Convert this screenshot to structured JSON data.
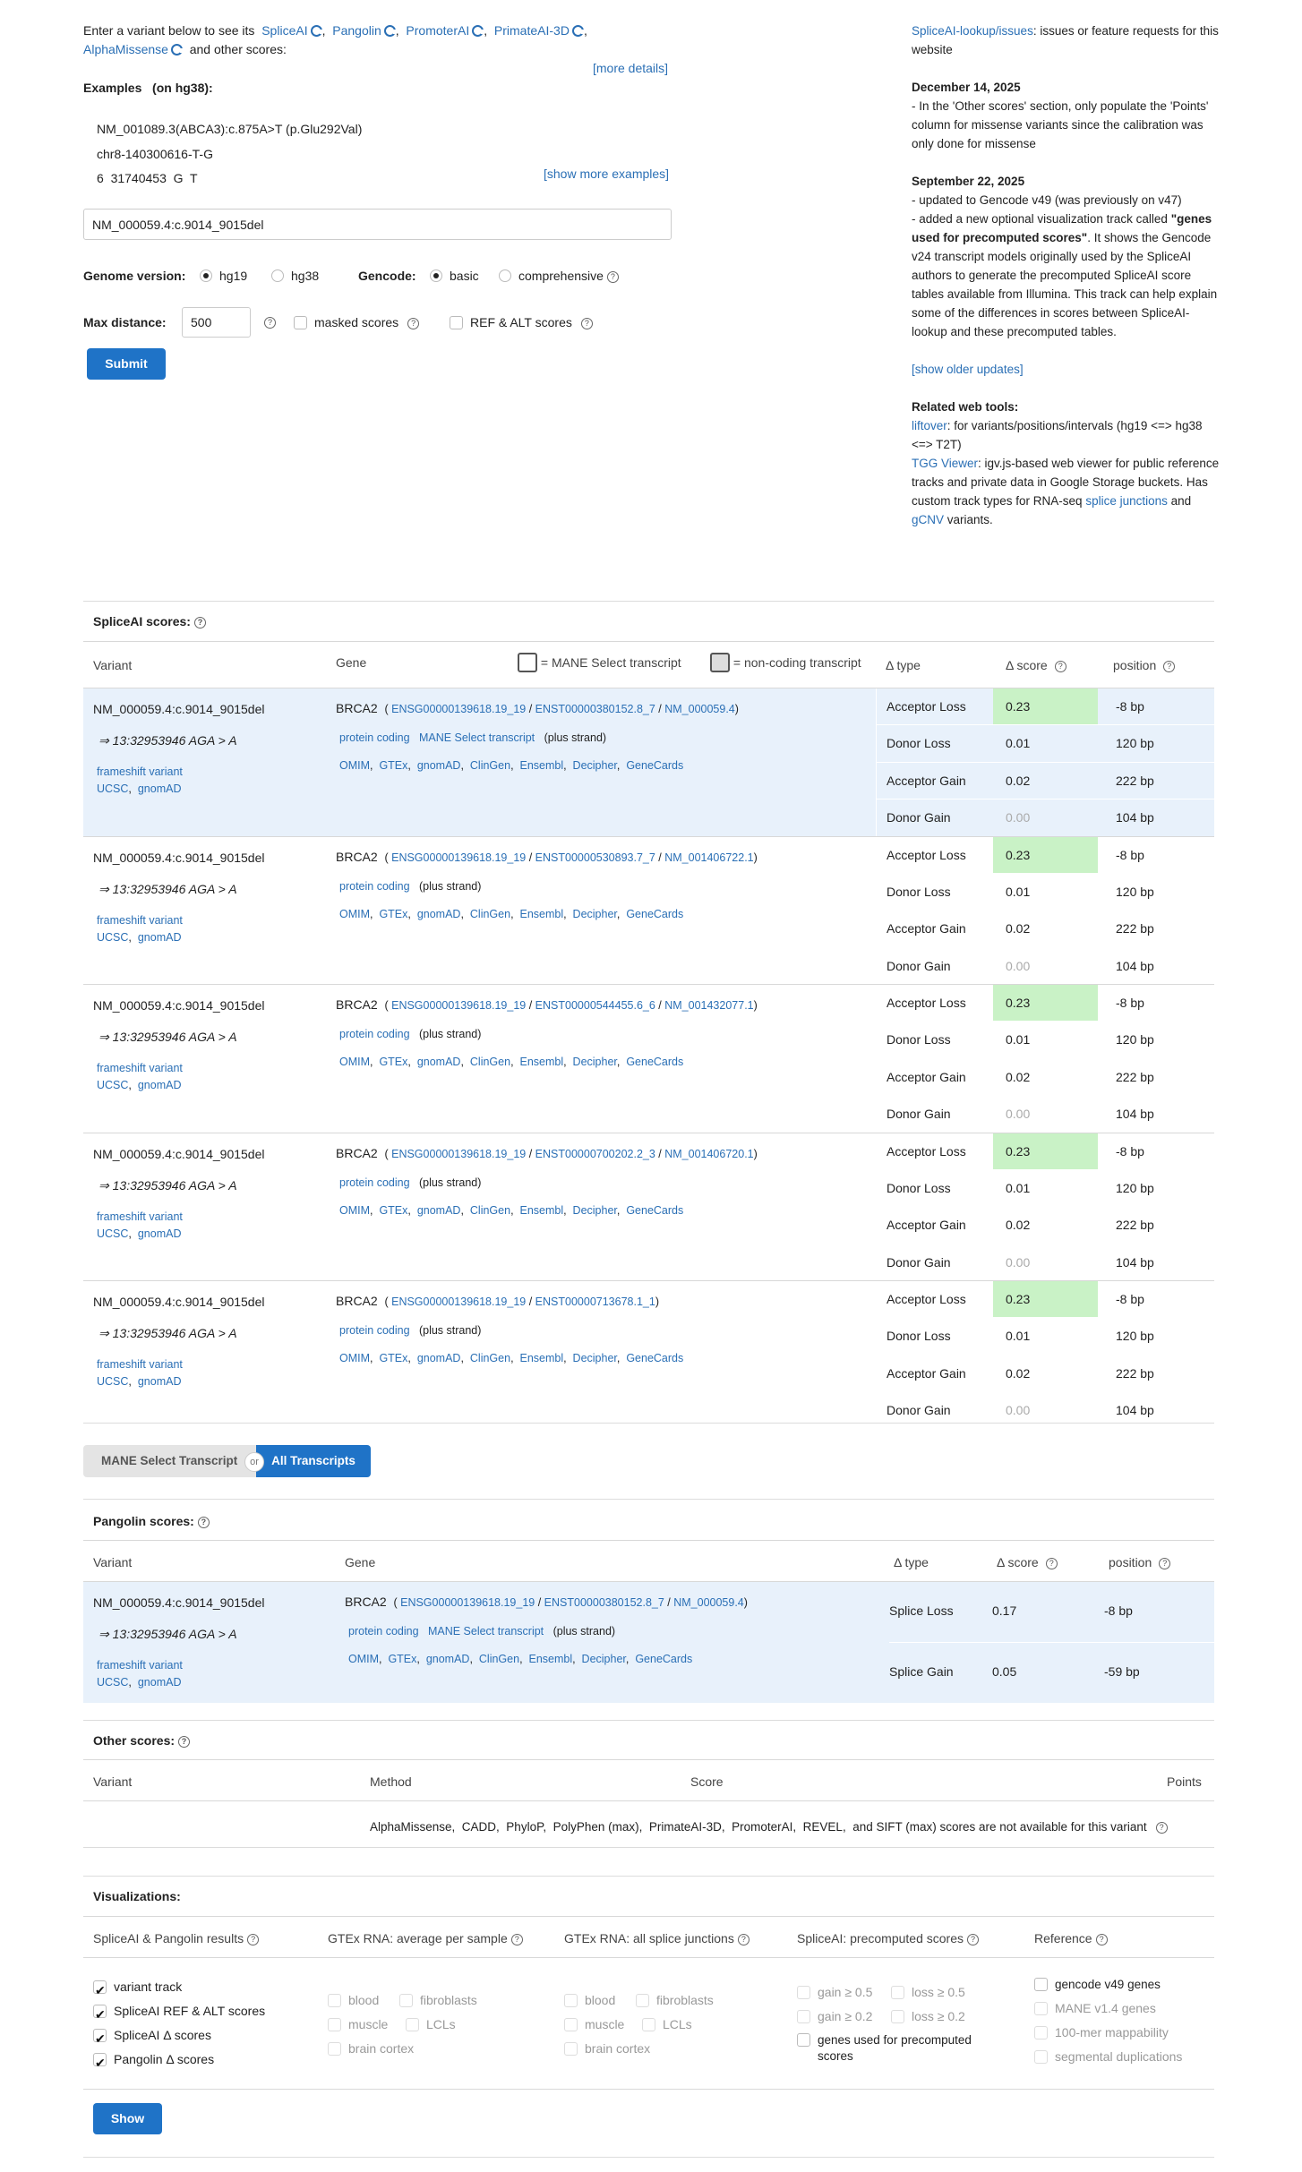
{
  "intro": {
    "text1": "Enter a variant below to see its",
    "tools": [
      "SpliceAI",
      "Pangolin",
      "PromoterAI",
      "PrimateAI-3D",
      "AlphaMissense"
    ],
    "text2": "and other scores:",
    "more_details": "[more details]"
  },
  "examples": {
    "title": "Examples",
    "on": "(on hg38):",
    "items": [
      "NM_001089.3(ABCA3):c.875A>T (p.Glu292Val)",
      "chr8-140300616-T-G",
      "6  31740453  G  T"
    ],
    "show_more": "[show more examples]"
  },
  "form": {
    "variant_value": "NM_000059.4:c.9014_9015del",
    "genome_label": "Genome version:",
    "genome_options": [
      "hg19",
      "hg38"
    ],
    "genome_selected": "hg19",
    "gencode_label": "Gencode:",
    "gencode_options": [
      "basic",
      "comprehensive"
    ],
    "gencode_selected": "basic",
    "maxdist_label": "Max distance:",
    "maxdist_value": "500",
    "masked_label": "masked scores",
    "refalt_label": "REF & ALT scores",
    "submit": "Submit"
  },
  "news": {
    "issues_link": "SpliceAI-lookup/issues",
    "issues_text": ": issues or feature requests for this website",
    "date1": "December 14, 2025",
    "text1": "- In the 'Other scores' section, only populate the 'Points' column for missense variants since the calibration was only done for missense",
    "date2": "September 22, 2025",
    "text2a": "- updated to Gencode v49 (was previously on v47)",
    "text2b": "- added a new optional visualization track called",
    "text2c": "\"genes used for precomputed scores\"",
    "text2d": ". It shows the Gencode v24 transcript models originally used by the SpliceAI authors to generate the precomputed SpliceAI score tables available from Illumina. This track can help explain some of the differences in scores between SpliceAI-lookup and these precomputed tables.",
    "older": "[show older updates]",
    "related_title": "Related web tools:",
    "liftover": "liftover",
    "liftover_text": ": for variants/positions/intervals (hg19 <=> hg38 <=> T2T)",
    "tgg": "TGG Viewer",
    "tgg_text": ": igv.js-based web viewer for public reference tracks and private data in Google Storage buckets. Has custom track types for RNA-seq",
    "splice_junctions": "splice junctions",
    "and": "and",
    "gcnv": "gCNV",
    "variants": "variants."
  },
  "spliceai": {
    "title": "SpliceAI scores:",
    "headers": {
      "variant": "Variant",
      "gene": "Gene",
      "mane_legend": "= MANE Select transcript",
      "noncoding_legend": "= non-coding transcript",
      "dtype": "Δ type",
      "dscore": "Δ score",
      "position": "position"
    },
    "rows": [
      {
        "variant": "NM_000059.4:c.9014_9015del",
        "coords": "⇒ 13:32953946 AGA > A",
        "consequence": "frameshift variant",
        "gene": "BRCA2",
        "gene_id": "ENSG00000139618.19_19",
        "transcript": "ENST00000380152.8_7",
        "refseq": "NM_000059.4",
        "biotype": "protein coding",
        "mane": "MANE Select transcript",
        "strand": "(plus strand)",
        "scores": [
          {
            "type": "Acceptor Loss",
            "score": "0.23",
            "pos": "-8 bp"
          },
          {
            "type": "Donor Loss",
            "score": "0.01",
            "pos": "120 bp"
          },
          {
            "type": "Acceptor Gain",
            "score": "0.02",
            "pos": "222 bp"
          },
          {
            "type": "Donor Gain",
            "score": "0.00",
            "pos": "104 bp"
          }
        ]
      },
      {
        "variant": "NM_000059.4:c.9014_9015del",
        "coords": "⇒ 13:32953946 AGA > A",
        "consequence": "frameshift variant",
        "gene": "BRCA2",
        "gene_id": "ENSG00000139618.19_19",
        "transcript": "ENST00000530893.7_7",
        "refseq": "NM_001406722.1",
        "biotype": "protein coding",
        "mane": "",
        "strand": "(plus strand)",
        "scores": [
          {
            "type": "Acceptor Loss",
            "score": "0.23",
            "pos": "-8 bp"
          },
          {
            "type": "Donor Loss",
            "score": "0.01",
            "pos": "120 bp"
          },
          {
            "type": "Acceptor Gain",
            "score": "0.02",
            "pos": "222 bp"
          },
          {
            "type": "Donor Gain",
            "score": "0.00",
            "pos": "104 bp"
          }
        ]
      },
      {
        "variant": "NM_000059.4:c.9014_9015del",
        "coords": "⇒ 13:32953946 AGA > A",
        "consequence": "frameshift variant",
        "gene": "BRCA2",
        "gene_id": "ENSG00000139618.19_19",
        "transcript": "ENST00000544455.6_6",
        "refseq": "NM_001432077.1",
        "biotype": "protein coding",
        "mane": "",
        "strand": "(plus strand)",
        "scores": [
          {
            "type": "Acceptor Loss",
            "score": "0.23",
            "pos": "-8 bp"
          },
          {
            "type": "Donor Loss",
            "score": "0.01",
            "pos": "120 bp"
          },
          {
            "type": "Acceptor Gain",
            "score": "0.02",
            "pos": "222 bp"
          },
          {
            "type": "Donor Gain",
            "score": "0.00",
            "pos": "104 bp"
          }
        ]
      },
      {
        "variant": "NM_000059.4:c.9014_9015del",
        "coords": "⇒ 13:32953946 AGA > A",
        "consequence": "frameshift variant",
        "gene": "BRCA2",
        "gene_id": "ENSG00000139618.19_19",
        "transcript": "ENST00000700202.2_3",
        "refseq": "NM_001406720.1",
        "biotype": "protein coding",
        "mane": "",
        "strand": "(plus strand)",
        "scores": [
          {
            "type": "Acceptor Loss",
            "score": "0.23",
            "pos": "-8 bp"
          },
          {
            "type": "Donor Loss",
            "score": "0.01",
            "pos": "120 bp"
          },
          {
            "type": "Acceptor Gain",
            "score": "0.02",
            "pos": "222 bp"
          },
          {
            "type": "Donor Gain",
            "score": "0.00",
            "pos": "104 bp"
          }
        ]
      },
      {
        "variant": "NM_000059.4:c.9014_9015del",
        "coords": "⇒ 13:32953946 AGA > A",
        "consequence": "frameshift variant",
        "gene": "BRCA2",
        "gene_id": "ENSG00000139618.19_19",
        "transcript": "ENST00000713678.1_1",
        "refseq": "",
        "biotype": "protein coding",
        "mane": "",
        "strand": "(plus strand)",
        "scores": [
          {
            "type": "Acceptor Loss",
            "score": "0.23",
            "pos": "-8 bp"
          },
          {
            "type": "Donor Loss",
            "score": "0.01",
            "pos": "120 bp"
          },
          {
            "type": "Acceptor Gain",
            "score": "0.02",
            "pos": "222 bp"
          },
          {
            "type": "Donor Gain",
            "score": "0.00",
            "pos": "104 bp"
          }
        ]
      }
    ],
    "links": [
      "UCSC",
      "gnomAD"
    ],
    "gene_links": [
      "OMIM",
      "GTEx",
      "gnomAD",
      "ClinGen",
      "Ensembl",
      "Decipher",
      "GeneCards"
    ],
    "toggle": {
      "mane": "MANE Select Transcript",
      "or": "or",
      "all": "All Transcripts"
    }
  },
  "pangolin": {
    "title": "Pangolin scores:",
    "headers": {
      "variant": "Variant",
      "gene": "Gene",
      "dtype": "Δ type",
      "dscore": "Δ score",
      "position": "position"
    },
    "row": {
      "variant": "NM_000059.4:c.9014_9015del",
      "coords": "⇒ 13:32953946 AGA > A",
      "consequence": "frameshift variant",
      "gene": "BRCA2",
      "gene_id": "ENSG00000139618.19_19",
      "transcript": "ENST00000380152.8_7",
      "refseq": "NM_000059.4",
      "biotype": "protein coding",
      "mane": "MANE Select transcript",
      "strand": "(plus strand)",
      "scores": [
        {
          "type": "Splice Loss",
          "score": "0.17",
          "pos": "-8 bp"
        },
        {
          "type": "Splice Gain",
          "score": "0.05",
          "pos": "-59 bp"
        }
      ]
    }
  },
  "other": {
    "title": "Other scores:",
    "headers": {
      "variant": "Variant",
      "method": "Method",
      "score": "Score",
      "points": "Points"
    },
    "message": "AlphaMissense,  CADD,  PhyloP,  PolyPhen (max),  PrimateAI-3D,  PromoterAI,  REVEL,  and SIFT (max) scores are not available for this variant"
  },
  "vis": {
    "title": "Visualizations:",
    "cols": [
      {
        "title": "SpliceAI & Pangolin results",
        "items": [
          {
            "label": "variant track",
            "checked": true
          },
          {
            "label": "SpliceAI REF & ALT scores",
            "checked": true
          },
          {
            "label": "SpliceAI Δ scores",
            "checked": true
          },
          {
            "label": "Pangolin Δ scores",
            "checked": true
          }
        ]
      },
      {
        "title": "GTEx RNA: average per sample",
        "items": [
          "blood",
          "fibroblasts",
          "muscle",
          "LCLs",
          "brain cortex"
        ]
      },
      {
        "title": "GTEx RNA: all splice junctions",
        "items": [
          "blood",
          "fibroblasts",
          "muscle",
          "LCLs",
          "brain cortex"
        ]
      },
      {
        "title": "SpliceAI: precomputed scores",
        "items": [
          "gain ≥ 0.5",
          "loss ≥ 0.5",
          "gain ≥ 0.2",
          "loss ≥ 0.2",
          "genes used for precomputed scores"
        ]
      },
      {
        "title": "Reference",
        "items": [
          "gencode v49 genes",
          "MANE v1.4 genes",
          "100-mer mappability",
          "segmental duplications"
        ]
      }
    ],
    "show": "Show"
  }
}
